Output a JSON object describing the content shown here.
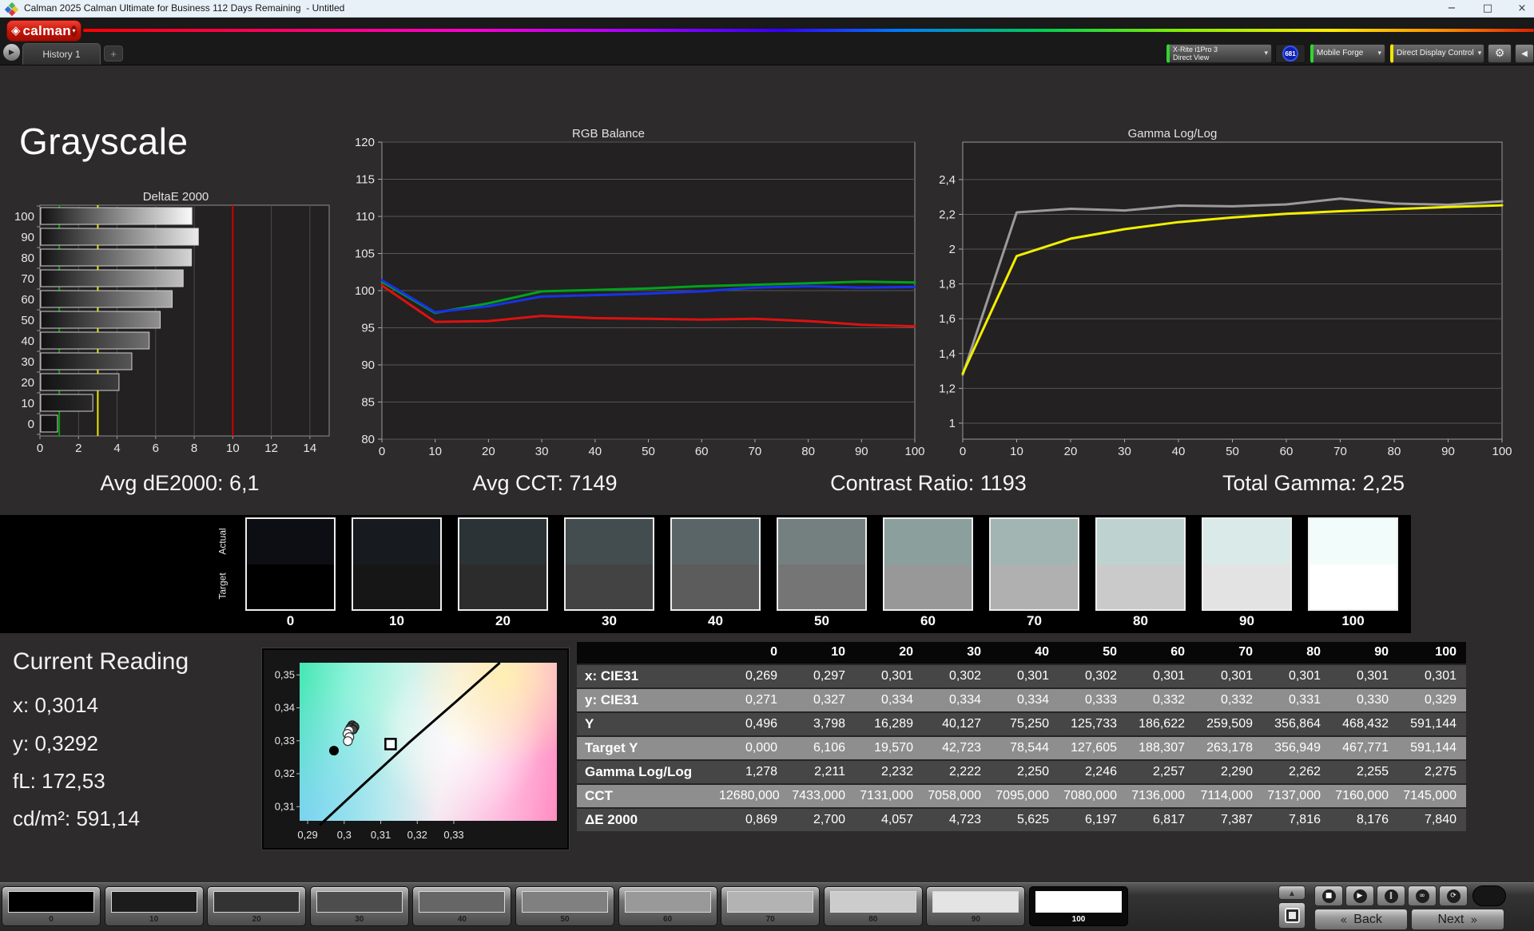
{
  "window": {
    "title": "Calman 2025 Calman Ultimate for Business 112 Days Remaining  - Untitled",
    "minimize": "−",
    "maximize": "□",
    "close": "×"
  },
  "brand": {
    "name": "calman",
    "diamond": "◈",
    "dropdown": "▾"
  },
  "tabs": {
    "history": "History 1",
    "add": "+",
    "play": "▶"
  },
  "meters": [
    {
      "lines": [
        "X-Rite i1Pro 3",
        "Direct View"
      ],
      "accent": "#2fd52f"
    },
    {
      "lines": [
        "Mobile Forge"
      ],
      "accent": "#2fd52f"
    },
    {
      "lines": [
        "Direct Display Control"
      ],
      "accent": "#f5e400"
    }
  ],
  "badge": "681",
  "icons": {
    "gear": "⚙",
    "collapse": "◀",
    "up": "▲",
    "stop": "■",
    "play": "▶",
    "step": "‖",
    "continuous": "∞",
    "loop": "⟳",
    "back_chev": "«",
    "next_chev": "»"
  },
  "page_title": "Grayscale",
  "stats": [
    {
      "text": "Avg dE2000: 6,1"
    },
    {
      "text": "Avg CCT: 7149"
    },
    {
      "text": "Contrast Ratio: 1193"
    },
    {
      "text": "Total Gamma: 2,25"
    }
  ],
  "chart_data": [
    {
      "type": "bar",
      "orientation": "horizontal",
      "title": "DeltaE 2000",
      "categories": [
        "100",
        "90",
        "80",
        "70",
        "60",
        "50",
        "40",
        "30",
        "20",
        "10",
        "0"
      ],
      "values": [
        7.84,
        8.176,
        7.816,
        7.387,
        6.817,
        6.197,
        5.625,
        4.723,
        4.057,
        2.7,
        0.869
      ],
      "xlim": [
        0,
        15
      ],
      "xticks": [
        0,
        2,
        4,
        6,
        8,
        10,
        12,
        14
      ],
      "reference_lines": [
        {
          "value": 1,
          "color": "#00a000"
        },
        {
          "value": 3,
          "color": "#e8e800"
        },
        {
          "value": 10,
          "color": "#d40000"
        }
      ],
      "bar_gradient_to": [
        "#fafafa",
        "#ebebeb",
        "#d5d5d5",
        "#c1c1c1",
        "#aaaaaa",
        "#909090",
        "#707070",
        "#565656",
        "#3d3d3d",
        "#292929",
        "#161616"
      ]
    },
    {
      "type": "line",
      "title": "RGB Balance",
      "x": [
        0,
        10,
        20,
        30,
        40,
        50,
        60,
        70,
        80,
        90,
        100
      ],
      "xticks": [
        0,
        10,
        20,
        30,
        40,
        50,
        60,
        70,
        80,
        90,
        100
      ],
      "ylim": [
        80,
        120
      ],
      "yticks": [
        120,
        115,
        110,
        105,
        100,
        95,
        90,
        85,
        80
      ],
      "grid": true,
      "legend": "none",
      "series": [
        {
          "name": "Red",
          "color": "#dd1111",
          "values": [
            100.7,
            95.8,
            95.9,
            96.6,
            96.3,
            96.2,
            96.1,
            96.2,
            95.9,
            95.4,
            95.2
          ]
        },
        {
          "name": "Green",
          "color": "#00a21f",
          "values": [
            101.2,
            97.0,
            98.3,
            99.9,
            100.1,
            100.3,
            100.6,
            100.8,
            101.0,
            101.2,
            101.1
          ]
        },
        {
          "name": "Blue",
          "color": "#1733e8",
          "values": [
            101.4,
            97.1,
            97.9,
            99.2,
            99.4,
            99.6,
            99.9,
            100.4,
            100.6,
            100.4,
            100.5
          ]
        }
      ]
    },
    {
      "type": "line",
      "title": "Gamma Log/Log",
      "x": [
        0,
        10,
        20,
        30,
        40,
        50,
        60,
        70,
        80,
        90,
        100
      ],
      "xticks": [
        0,
        10,
        20,
        30,
        40,
        50,
        60,
        70,
        80,
        90,
        100
      ],
      "ylim": [
        1,
        2.4
      ],
      "yticks": [
        2.4,
        2.2,
        2.0,
        1.8,
        1.6,
        1.4,
        1.2,
        1.0
      ],
      "ytick_labels": [
        "2,4",
        "2,2",
        "2",
        "1,8",
        "1,6",
        "1,4",
        "1,2",
        "1"
      ],
      "grid": true,
      "legend": "none",
      "series": [
        {
          "name": "Gamma points",
          "color": "#9b9b9b",
          "values": [
            1.278,
            2.211,
            2.232,
            2.222,
            2.25,
            2.246,
            2.257,
            2.29,
            2.262,
            2.255,
            2.275
          ]
        },
        {
          "name": "Gamma smoothed",
          "color": "#f2ef00",
          "values": [
            1.285,
            1.96,
            2.06,
            2.115,
            2.155,
            2.182,
            2.203,
            2.218,
            2.23,
            2.242,
            2.252
          ]
        }
      ]
    },
    {
      "type": "scatter",
      "title": "CIE 1931 xy detail",
      "xlim": [
        0.2878,
        0.3582
      ],
      "ylim": [
        0.3057,
        0.3537
      ],
      "xticks": [
        0.29,
        0.3,
        0.31,
        0.32,
        0.33
      ],
      "xtick_labels": [
        "0,29",
        "0,3",
        "0,31",
        "0,32",
        "0,33"
      ],
      "yticks": [
        0.35,
        0.34,
        0.33,
        0.32,
        0.31
      ],
      "ytick_labels": [
        "0,35",
        "0,34",
        "0,33",
        "0,32",
        "0,31"
      ],
      "locus": [
        [
          0.2933,
          0.3044
        ],
        [
          0.305,
          0.3165
        ],
        [
          0.318,
          0.3297
        ],
        [
          0.3305,
          0.3418
        ],
        [
          0.3426,
          0.3537
        ]
      ],
      "cluster_dark": [
        [
          0.3022,
          0.3347
        ],
        [
          0.3028,
          0.3342
        ],
        [
          0.3017,
          0.3339
        ],
        [
          0.3024,
          0.3334
        ]
      ],
      "cluster_white": [
        [
          0.3013,
          0.3331
        ],
        [
          0.3009,
          0.3321
        ],
        [
          0.3014,
          0.3311
        ],
        [
          0.301,
          0.3299
        ]
      ],
      "single_black": [
        0.2972,
        0.327
      ],
      "target_square": [
        0.3127,
        0.329
      ]
    }
  ],
  "swatch_strip": {
    "row_labels": [
      "Actual",
      "Target"
    ],
    "levels": [
      "0",
      "10",
      "20",
      "30",
      "40",
      "50",
      "60",
      "70",
      "80",
      "90",
      "100"
    ],
    "actual": [
      "#0c0e13",
      "#171b20",
      "#2c3336",
      "#434c4f",
      "#5a6567",
      "#73807f",
      "#8b9f9d",
      "#a2b5b2",
      "#bed3d0",
      "#daeae8",
      "#f2fdfb"
    ],
    "target": [
      "#000000",
      "#161616",
      "#2c2c2c",
      "#434343",
      "#5c5c5c",
      "#757575",
      "#989898",
      "#b0b0b0",
      "#cacaca",
      "#e3e3e3",
      "#ffffff"
    ]
  },
  "current_reading": {
    "title": "Current Reading",
    "lines": [
      "x: 0,3014",
      "y: 0,3292",
      "fL: 172,53",
      "cd/m²: 591,14"
    ]
  },
  "table": {
    "columns": [
      "",
      "0",
      "10",
      "20",
      "30",
      "40",
      "50",
      "60",
      "70",
      "80",
      "90",
      "100"
    ],
    "rows": [
      {
        "label": "x: CIE31",
        "values": [
          "0,269",
          "0,297",
          "0,301",
          "0,302",
          "0,301",
          "0,302",
          "0,301",
          "0,301",
          "0,301",
          "0,301",
          "0,301"
        ]
      },
      {
        "label": "y: CIE31",
        "values": [
          "0,271",
          "0,327",
          "0,334",
          "0,334",
          "0,334",
          "0,333",
          "0,332",
          "0,332",
          "0,331",
          "0,330",
          "0,329"
        ]
      },
      {
        "label": "Y",
        "values": [
          "0,496",
          "3,798",
          "16,289",
          "40,127",
          "75,250",
          "125,733",
          "186,622",
          "259,509",
          "356,864",
          "468,432",
          "591,144"
        ]
      },
      {
        "label": "Target Y",
        "values": [
          "0,000",
          "6,106",
          "19,570",
          "42,723",
          "78,544",
          "127,605",
          "188,307",
          "263,178",
          "356,949",
          "467,771",
          "591,144"
        ]
      },
      {
        "label": "Gamma Log/Log",
        "values": [
          "1,278",
          "2,211",
          "2,232",
          "2,222",
          "2,250",
          "2,246",
          "2,257",
          "2,290",
          "2,262",
          "2,255",
          "2,275"
        ]
      },
      {
        "label": "CCT",
        "values": [
          "12680,000",
          "7433,000",
          "7131,000",
          "7058,000",
          "7095,000",
          "7080,000",
          "7136,000",
          "7114,000",
          "7137,000",
          "7160,000",
          "7145,000"
        ]
      },
      {
        "label": "ΔE 2000",
        "values": [
          "0,869",
          "2,700",
          "4,057",
          "4,723",
          "5,625",
          "6,197",
          "6,817",
          "7,387",
          "7,816",
          "8,176",
          "7,840"
        ]
      }
    ]
  },
  "bottom": {
    "patches": [
      {
        "label": "0",
        "color": "#000000"
      },
      {
        "label": "10",
        "color": "#1c1c1c"
      },
      {
        "label": "20",
        "color": "#333333"
      },
      {
        "label": "30",
        "color": "#4d4d4d"
      },
      {
        "label": "40",
        "color": "#666666"
      },
      {
        "label": "50",
        "color": "#808080"
      },
      {
        "label": "60",
        "color": "#999999"
      },
      {
        "label": "70",
        "color": "#b3b3b3"
      },
      {
        "label": "80",
        "color": "#cccccc"
      },
      {
        "label": "90",
        "color": "#e4e4e4"
      },
      {
        "label": "100",
        "color": "#ffffff",
        "selected": true
      }
    ],
    "back": "Back",
    "next": "Next"
  }
}
